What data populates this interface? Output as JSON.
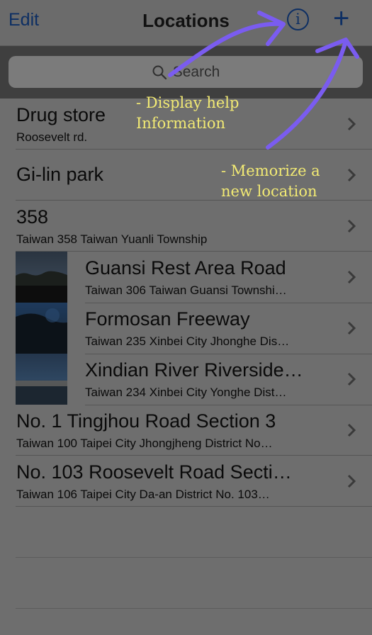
{
  "nav": {
    "edit_label": "Edit",
    "title": "Locations",
    "info_glyph": "i",
    "add_glyph": "+"
  },
  "search": {
    "placeholder": "Search"
  },
  "locations": [
    {
      "title": "Drug store",
      "subtitle": "Roosevelt rd.",
      "thumb": false
    },
    {
      "title": "Gi-lin park",
      "subtitle": "",
      "thumb": false
    },
    {
      "title": "358",
      "subtitle": "Taiwan 358 Taiwan Yuanli Township",
      "thumb": false
    },
    {
      "title": "Guansi Rest Area Road",
      "subtitle": "Taiwan 306 Taiwan Guansi Townshi…",
      "thumb": true
    },
    {
      "title": "Formosan Freeway",
      "subtitle": "Taiwan 235 Xinbei City Jhonghe Dis…",
      "thumb": true
    },
    {
      "title": "Xindian River Riverside…",
      "subtitle": "Taiwan 234 Xinbei City Yonghe Dist…",
      "thumb": true
    },
    {
      "title": "No. 1 Tingjhou Road Section 3",
      "subtitle": "Taiwan 100 Taipei City Jhongjheng District No…",
      "thumb": false
    },
    {
      "title": "No. 103 Roosevelt Road Secti…",
      "subtitle": "Taiwan 106 Taipei City Da-an District No. 103…",
      "thumb": false
    }
  ],
  "annotations": {
    "help_line1": "- Display help",
    "help_line2": "Information",
    "add_line1": "- Memorize a",
    "add_line2": "new location"
  },
  "colors": {
    "annotation_text": "#f2ea74",
    "annotation_arrow": "#7a5cf0",
    "tint": "#0e2f63"
  }
}
